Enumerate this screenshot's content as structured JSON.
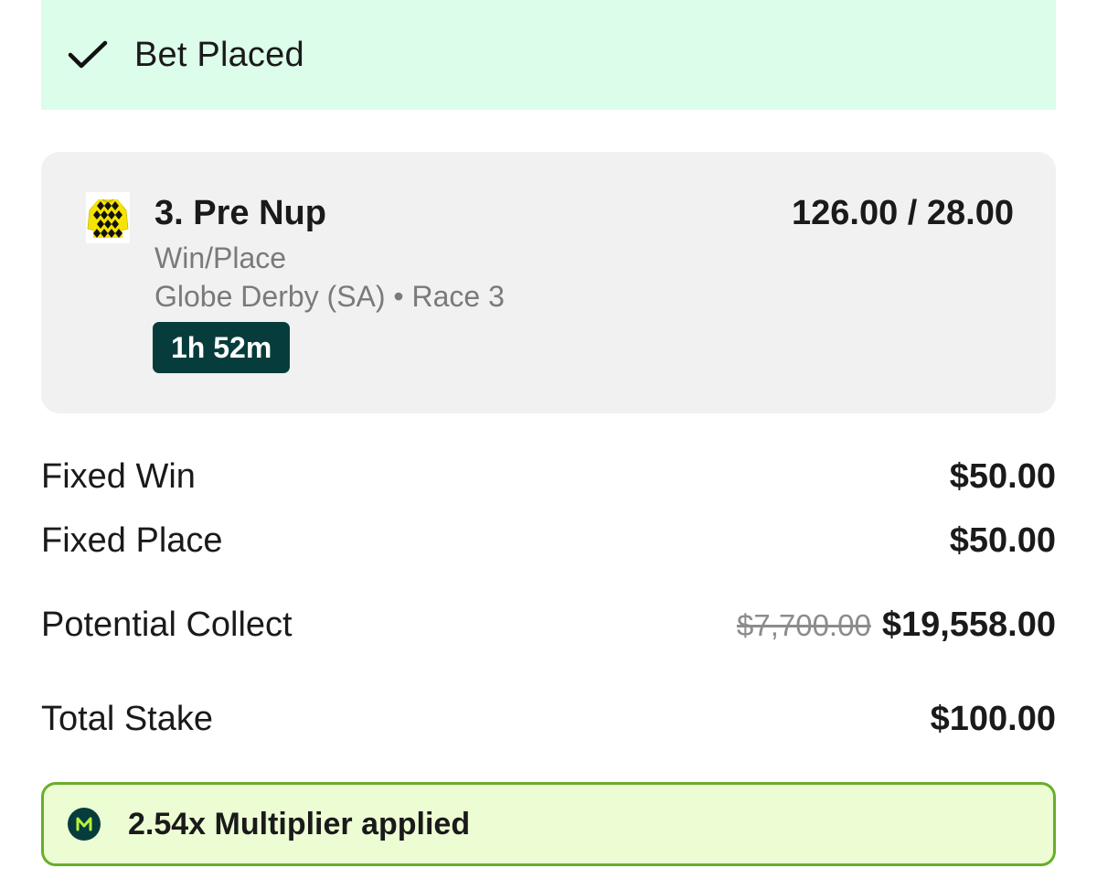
{
  "banner": {
    "title": "Bet Placed",
    "background": "#dcfdea",
    "icon": "check-icon"
  },
  "selection": {
    "runner": "3. Pre Nup",
    "odds": "126.00 / 28.00",
    "bet_type": "Win/Place",
    "meeting": "Globe Derby (SA) • Race 3",
    "countdown": "1h 52m",
    "silk_icon": "jockey-silk-icon",
    "silk_colors": [
      "#f5e400",
      "#111111"
    ],
    "countdown_color": "#063c3c"
  },
  "rows": {
    "fixed_win": {
      "label": "Fixed Win",
      "value": "$50.00"
    },
    "fixed_place": {
      "label": "Fixed Place",
      "value": "$50.00"
    },
    "potential_collect": {
      "label": "Potential Collect",
      "old_value": "$7,700.00",
      "value": "$19,558.00"
    },
    "total_stake": {
      "label": "Total Stake",
      "value": "$100.00"
    }
  },
  "multiplier": {
    "text": "2.54x Multiplier applied",
    "icon": "multiplier-m-icon",
    "border_color": "#6aad2c",
    "background": "#ecfdd4"
  }
}
